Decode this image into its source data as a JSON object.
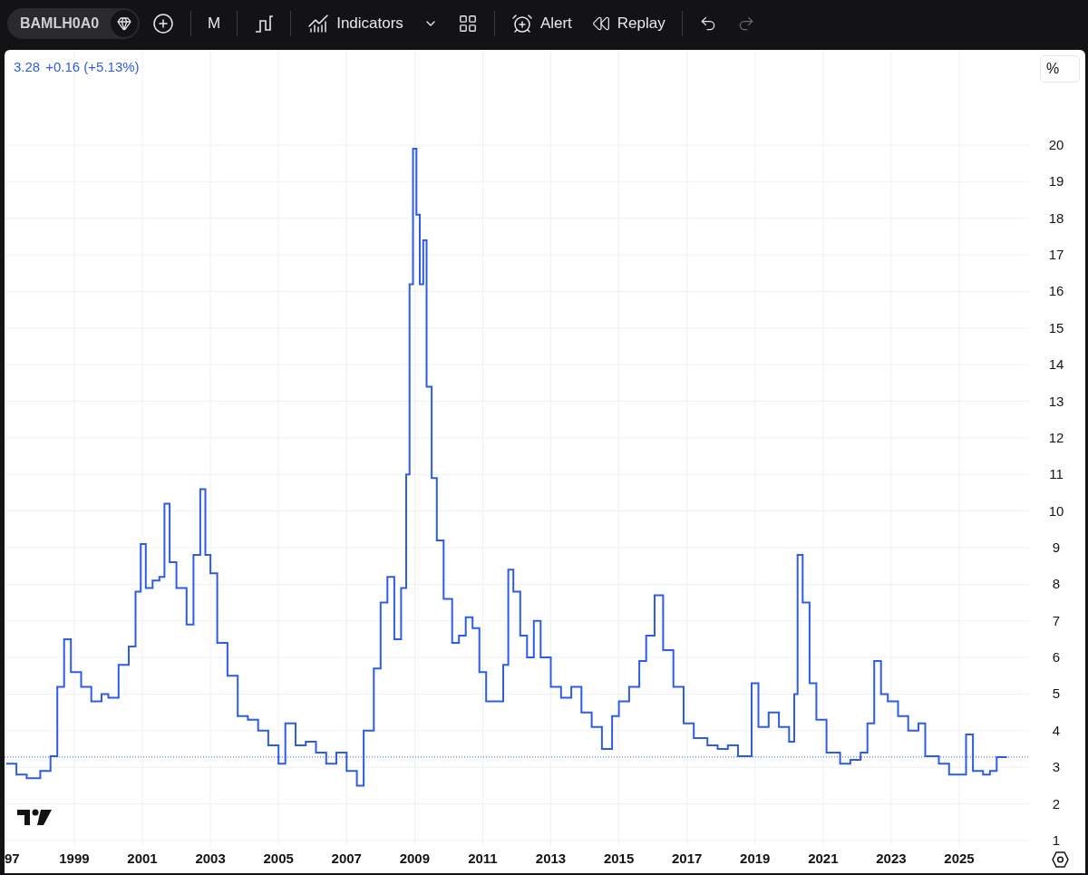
{
  "toolbar": {
    "symbol": "BAMLH0A0",
    "interval": "M",
    "indicators": "Indicators",
    "alert": "Alert",
    "replay": "Replay",
    "redo": {
      "disabled": true
    }
  },
  "legend": {
    "value": "3.28",
    "change": "+0.16 (+5.13%)"
  },
  "price_scale": {
    "unit": "%"
  },
  "chart_data": {
    "type": "line",
    "grid": true,
    "ylim": [
      0.85,
      22.6
    ],
    "xlim": [
      1996.95,
      2027.05
    ],
    "yticks": [
      1,
      2,
      3,
      4,
      5,
      6,
      7,
      8,
      9,
      10,
      11,
      12,
      13,
      14,
      15,
      16,
      17,
      18,
      19,
      20
    ],
    "xticks": [
      {
        "value": 1997,
        "label": "97"
      },
      {
        "value": 1999,
        "label": "1999"
      },
      {
        "value": 2001,
        "label": "2001"
      },
      {
        "value": 2003,
        "label": "2003"
      },
      {
        "value": 2005,
        "label": "2005"
      },
      {
        "value": 2007,
        "label": "2007"
      },
      {
        "value": 2009,
        "label": "2009"
      },
      {
        "value": 2011,
        "label": "2011"
      },
      {
        "value": 2013,
        "label": "2013"
      },
      {
        "value": 2015,
        "label": "2015"
      },
      {
        "value": 2017,
        "label": "2017"
      },
      {
        "value": 2019,
        "label": "2019"
      },
      {
        "value": 2021,
        "label": "2021"
      },
      {
        "value": 2023,
        "label": "2023"
      },
      {
        "value": 2025,
        "label": "2025"
      }
    ],
    "ref_lines": [
      {
        "axis": "y",
        "value": 3.28,
        "color": "#2e5ce6"
      }
    ],
    "x": [
      1997.0,
      1997.3,
      1997.3,
      1997.6,
      1997.6,
      1998.0,
      1998.0,
      1998.3,
      1998.3,
      1998.5,
      1998.5,
      1998.7,
      1998.7,
      1998.9,
      1998.9,
      1999.2,
      1999.2,
      1999.5,
      1999.5,
      1999.8,
      1999.8,
      2000.0,
      2000.0,
      2000.3,
      2000.3,
      2000.6,
      2000.6,
      2000.8,
      2000.8,
      2000.95,
      2000.95,
      2001.1,
      2001.1,
      2001.3,
      2001.3,
      2001.5,
      2001.5,
      2001.65,
      2001.65,
      2001.8,
      2001.8,
      2002.0,
      2002.0,
      2002.3,
      2002.3,
      2002.5,
      2002.5,
      2002.7,
      2002.7,
      2002.85,
      2002.85,
      2003.0,
      2003.0,
      2003.2,
      2003.2,
      2003.5,
      2003.5,
      2003.8,
      2003.8,
      2004.1,
      2004.1,
      2004.4,
      2004.4,
      2004.7,
      2004.7,
      2005.0,
      2005.0,
      2005.2,
      2005.2,
      2005.5,
      2005.5,
      2005.8,
      2005.8,
      2006.1,
      2006.1,
      2006.4,
      2006.4,
      2006.7,
      2006.7,
      2007.0,
      2007.0,
      2007.3,
      2007.3,
      2007.5,
      2007.5,
      2007.8,
      2007.8,
      2008.0,
      2008.0,
      2008.2,
      2008.2,
      2008.4,
      2008.4,
      2008.6,
      2008.6,
      2008.75,
      2008.75,
      2008.85,
      2008.85,
      2008.95,
      2008.95,
      2009.05,
      2009.05,
      2009.15,
      2009.15,
      2009.25,
      2009.25,
      2009.35,
      2009.35,
      2009.5,
      2009.5,
      2009.65,
      2009.65,
      2009.85,
      2009.85,
      2010.1,
      2010.1,
      2010.3,
      2010.3,
      2010.5,
      2010.5,
      2010.7,
      2010.7,
      2010.9,
      2010.9,
      2011.1,
      2011.1,
      2011.4,
      2011.4,
      2011.6,
      2011.6,
      2011.75,
      2011.75,
      2011.9,
      2011.9,
      2012.1,
      2012.1,
      2012.3,
      2012.3,
      2012.5,
      2012.5,
      2012.7,
      2012.7,
      2013.0,
      2013.0,
      2013.3,
      2013.3,
      2013.6,
      2013.6,
      2013.9,
      2013.9,
      2014.2,
      2014.2,
      2014.5,
      2014.5,
      2014.8,
      2014.8,
      2015.0,
      2015.0,
      2015.3,
      2015.3,
      2015.6,
      2015.6,
      2015.8,
      2015.8,
      2016.05,
      2016.05,
      2016.3,
      2016.3,
      2016.6,
      2016.6,
      2016.9,
      2016.9,
      2017.2,
      2017.2,
      2017.6,
      2017.6,
      2017.9,
      2017.9,
      2018.2,
      2018.2,
      2018.5,
      2018.5,
      2018.9,
      2018.9,
      2019.1,
      2019.1,
      2019.4,
      2019.4,
      2019.7,
      2019.7,
      2020.0,
      2020.0,
      2020.15,
      2020.15,
      2020.25,
      2020.25,
      2020.4,
      2020.4,
      2020.6,
      2020.6,
      2020.8,
      2020.8,
      2021.1,
      2021.1,
      2021.5,
      2021.5,
      2021.8,
      2021.8,
      2022.1,
      2022.1,
      2022.3,
      2022.3,
      2022.5,
      2022.5,
      2022.7,
      2022.7,
      2022.9,
      2022.9,
      2023.2,
      2023.2,
      2023.5,
      2023.5,
      2023.8,
      2023.8,
      2024.0,
      2024.0,
      2024.4,
      2024.4,
      2024.7,
      2024.7,
      2025.0,
      2025.0,
      2025.2,
      2025.2,
      2025.4,
      2025.4,
      2025.7,
      2025.7,
      2025.9,
      2025.9,
      2026.1,
      2026.1,
      2026.4
    ],
    "series": [
      {
        "color": "#2e5ce6",
        "values": [
          3.1,
          3.1,
          2.8,
          2.8,
          2.7,
          2.7,
          2.9,
          2.9,
          3.3,
          3.3,
          5.2,
          5.2,
          6.5,
          6.5,
          5.6,
          5.6,
          5.2,
          5.2,
          4.8,
          4.8,
          5.0,
          5.0,
          4.9,
          4.9,
          5.8,
          5.8,
          6.3,
          6.3,
          7.8,
          7.8,
          9.1,
          9.1,
          7.9,
          7.9,
          8.1,
          8.1,
          8.2,
          8.2,
          10.2,
          10.2,
          8.6,
          8.6,
          7.9,
          7.9,
          6.9,
          6.9,
          8.8,
          8.8,
          10.6,
          10.6,
          8.8,
          8.8,
          8.3,
          8.3,
          6.4,
          6.4,
          5.5,
          5.5,
          4.4,
          4.4,
          4.3,
          4.3,
          4.0,
          4.0,
          3.6,
          3.6,
          3.1,
          3.1,
          4.2,
          4.2,
          3.6,
          3.6,
          3.7,
          3.7,
          3.4,
          3.4,
          3.1,
          3.1,
          3.4,
          3.4,
          2.9,
          2.9,
          2.5,
          2.5,
          4.0,
          4.0,
          5.7,
          5.7,
          7.5,
          7.5,
          8.2,
          8.2,
          6.5,
          6.5,
          7.9,
          7.9,
          11.0,
          11.0,
          16.2,
          16.2,
          19.9,
          19.9,
          18.1,
          18.1,
          16.2,
          16.2,
          17.4,
          17.4,
          13.4,
          13.4,
          10.9,
          10.9,
          9.2,
          9.2,
          7.6,
          7.6,
          6.4,
          6.4,
          6.6,
          6.6,
          7.1,
          7.1,
          6.8,
          6.8,
          5.6,
          5.6,
          4.8,
          4.8,
          4.8,
          4.8,
          5.8,
          5.8,
          8.4,
          8.4,
          7.8,
          7.8,
          6.6,
          6.6,
          6.0,
          6.0,
          7.0,
          7.0,
          6.0,
          6.0,
          5.2,
          5.2,
          4.9,
          4.9,
          5.2,
          5.2,
          4.5,
          4.5,
          4.1,
          4.1,
          3.5,
          3.5,
          4.4,
          4.4,
          4.8,
          4.8,
          5.2,
          5.2,
          5.9,
          5.9,
          6.6,
          6.6,
          7.7,
          7.7,
          6.2,
          6.2,
          5.2,
          5.2,
          4.2,
          4.2,
          3.8,
          3.8,
          3.6,
          3.6,
          3.5,
          3.5,
          3.6,
          3.6,
          3.3,
          3.3,
          5.3,
          5.3,
          4.1,
          4.1,
          4.5,
          4.5,
          4.1,
          4.1,
          3.7,
          3.7,
          5.0,
          5.0,
          8.8,
          8.8,
          7.5,
          7.5,
          5.3,
          5.3,
          4.3,
          4.3,
          3.4,
          3.4,
          3.1,
          3.1,
          3.2,
          3.2,
          3.4,
          3.4,
          4.2,
          4.2,
          5.9,
          5.9,
          5.0,
          5.0,
          4.8,
          4.8,
          4.4,
          4.4,
          4.0,
          4.0,
          4.2,
          4.2,
          3.3,
          3.3,
          3.1,
          3.1,
          2.8,
          2.8,
          2.8,
          2.8,
          3.9,
          3.9,
          2.9,
          2.9,
          2.8,
          2.8,
          2.9,
          2.9,
          3.28,
          3.28
        ]
      }
    ]
  }
}
